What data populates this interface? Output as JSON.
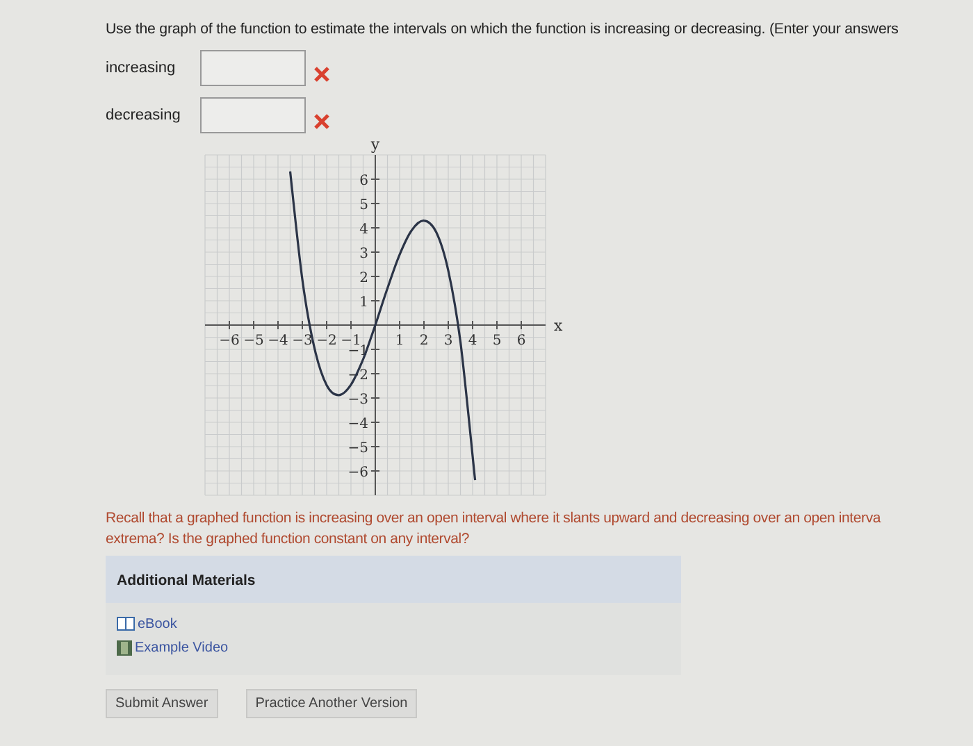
{
  "question": {
    "prompt": "Use the graph of the function to estimate the intervals on which the function is increasing or decreasing. (Enter your answers"
  },
  "answers": [
    {
      "label": "increasing",
      "correct": false
    },
    {
      "label": "decreasing",
      "correct": false
    }
  ],
  "graph": {
    "chart_data": {
      "type": "line",
      "xlabel": "x",
      "ylabel": "y",
      "x": [
        -3.5,
        -3,
        -2.5,
        -2,
        -1.5,
        -1,
        -0.5,
        0,
        0.5,
        1,
        1.5,
        2,
        2.5,
        3,
        3.5,
        4.1
      ],
      "grid": true,
      "series": [
        {
          "color": "#2b3447",
          "values": [
            6.32,
            1.88,
            -0.96,
            -2.47,
            -2.88,
            -2.45,
            -1.4,
            0,
            1.52,
            2.9,
            3.91,
            4.3,
            3.83,
            2.24,
            -0.71,
            -6.38
          ]
        }
      ],
      "xlim": [
        -7,
        7
      ],
      "ylim": [
        -7,
        7
      ],
      "xticks": [
        -6,
        -5,
        -4,
        -3,
        -2,
        -1,
        1,
        2,
        3,
        4,
        5,
        6
      ],
      "yticks": [
        -6,
        -5,
        -4,
        -3,
        -2,
        -1,
        1,
        2,
        3,
        4,
        5,
        6
      ]
    }
  },
  "hint": {
    "lines": [
      "Recall that a graphed function is increasing over an open interval where it slants upward and decreasing over an open interva",
      "extrema? Is the graphed function constant on any interval?"
    ]
  },
  "materials": {
    "title": "Additional Materials",
    "links": [
      {
        "kind": "book",
        "label": "eBook"
      },
      {
        "kind": "video",
        "label": "Example Video"
      }
    ]
  },
  "buttons": [
    "Submit Answer",
    "Practice Another Version"
  ]
}
